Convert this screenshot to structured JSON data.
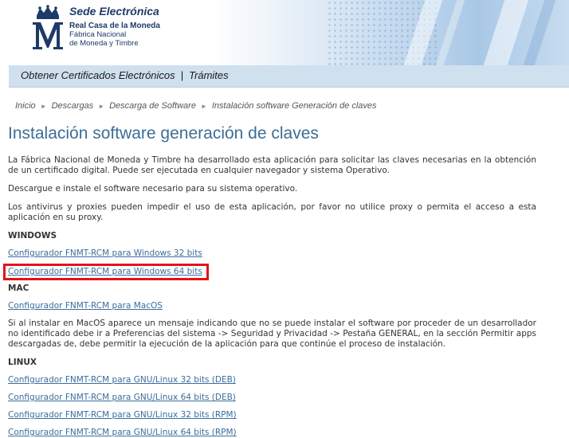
{
  "header": {
    "brand_title": "Sede Electrónica",
    "brand_line1": "Real Casa de la Moneda",
    "brand_line2": "Fábrica Nacional",
    "brand_line3": "de Moneda y Timbre"
  },
  "nav": {
    "item1": "Obtener Certificados Electrónicos",
    "separator": "|",
    "item2": "Trámites"
  },
  "breadcrumb": {
    "items": [
      "Inicio",
      "Descargas",
      "Descarga de Software",
      "Instalación software Generación de claves"
    ]
  },
  "main": {
    "title": "Instalación software generación de claves",
    "intro": "La Fábrica Nacional de Moneda y Timbre ha desarrollado esta aplicación para solicitar las claves necesarias en la obtención de un certificado digital. Puede ser ejecutada en cualquier navegador y sistema Operativo.",
    "instruction": "Descargue e instale el software necesario para su sistema operativo.",
    "warning": "Los antivirus y proxies pueden impedir el uso de esta aplicación, por favor no utilice proxy o permita el acceso a esta aplicación en su proxy.",
    "windows": {
      "heading": "WINDOWS",
      "links": [
        "Configurador FNMT-RCM para Windows 32 bits",
        "Configurador FNMT-RCM para Windows 64 bits"
      ]
    },
    "mac": {
      "heading": "MAC",
      "links": [
        "Configurador FNMT-RCM para MacOS"
      ],
      "note": "Si al instalar en MacOS aparece un mensaje indicando que no se puede instalar el software por proceder de un desarrollador no identificado debe ir a Preferencias del sistema -> Seguridad y Privacidad -> Pestaña GENERAL, en la sección Permitir apps descargadas de, debe permitir la ejecución de la aplicación para que continúe el proceso de instalación."
    },
    "linux": {
      "heading": "LINUX",
      "links": [
        "Configurador FNMT-RCM para GNU/Linux 32 bits (DEB)",
        "Configurador FNMT-RCM para GNU/Linux 64 bits (DEB)",
        "Configurador FNMT-RCM para GNU/Linux 32 bits (RPM)",
        "Configurador FNMT-RCM para GNU/Linux 64 bits (RPM)"
      ]
    }
  },
  "colors": {
    "title_blue": "#3d6d97",
    "link_blue": "#3a6d9c",
    "nav_bg": "#cfe0ef",
    "highlight_red": "#e0141c"
  }
}
